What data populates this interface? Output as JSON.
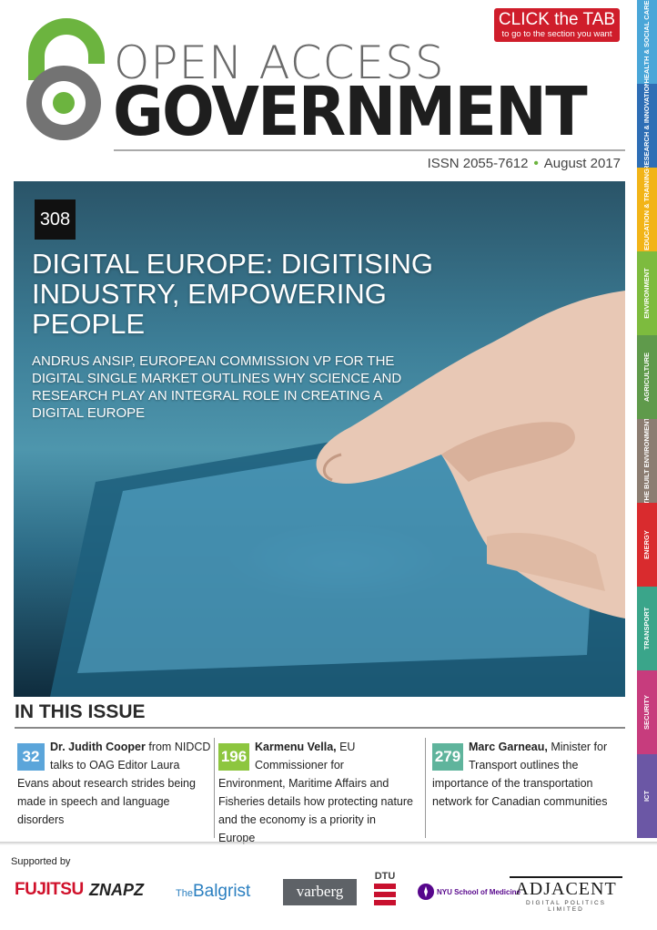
{
  "header": {
    "title_line1": "OPEN ACCESS",
    "title_line2": "GOVERNMENT",
    "issn": "ISSN 2055-7612",
    "date": "August 2017",
    "click_tab": "CLICK the TAB",
    "click_tab_sub": "to go to the section you want"
  },
  "tabs": [
    {
      "label": "HEALTH & SOCIAL CARE",
      "color": "#4aa6d8"
    },
    {
      "label": "RESEARCH & INNOVATION",
      "color": "#2e6eb5"
    },
    {
      "label": "EDUCATION & TRAINING",
      "color": "#f2b418"
    },
    {
      "label": "ENVIRONMENT",
      "color": "#7dbb3e"
    },
    {
      "label": "AGRICULTURE",
      "color": "#5f9a4b"
    },
    {
      "label": "THE BUILT ENVIRONMENT",
      "color": "#8c7d72"
    },
    {
      "label": "ENERGY",
      "color": "#d92b2e"
    },
    {
      "label": "TRANSPORT",
      "color": "#3aa58a"
    },
    {
      "label": "SECURITY",
      "color": "#c73c7d"
    },
    {
      "label": "ICT",
      "color": "#6b57a5"
    }
  ],
  "hero": {
    "issue_number": "308",
    "headline": "DIGITAL EUROPE: DIGITISING INDUSTRY, EMPOWERING PEOPLE",
    "subhead": "ANDRUS ANSIP, EUROPEAN COMMISSION VP FOR THE DIGITAL SINGLE MARKET OUTLINES WHY SCIENCE AND RESEARCH PLAY AN INTEGRAL ROLE IN CREATING A DIGITAL EUROPE"
  },
  "in_this_issue": {
    "heading": "IN THIS ISSUE",
    "items": [
      {
        "number": "32",
        "color": "#5ba5da",
        "name": "Dr. Judith Cooper",
        "text": " from NIDCD talks to OAG Editor Laura Evans about research strides being made in speech and language disorders"
      },
      {
        "number": "196",
        "color": "#8dc63f",
        "name": "Karmenu Vella,",
        "text": " EU Commissioner for Environment, Maritime Affairs and Fisheries details how protecting nature and the economy is a priority in Europe"
      },
      {
        "number": "279",
        "color": "#5fb49c",
        "name": "Marc Garneau,",
        "text": " Minister for Transport outlines the importance of the transportation network for Canadian communities"
      }
    ]
  },
  "supporters": {
    "label": "Supported by",
    "logos": {
      "fujitsu": "FUJITSU",
      "znapz": "ZNAPZ",
      "balgrist_the": "The",
      "balgrist": "Balgrist",
      "varberg": "varberg",
      "dtu": "DTU",
      "nyu": "NYU School of Medicine",
      "adjacent": "ADJACENT",
      "adjacent_sub": "DIGITAL POLITICS LIMITED"
    }
  }
}
